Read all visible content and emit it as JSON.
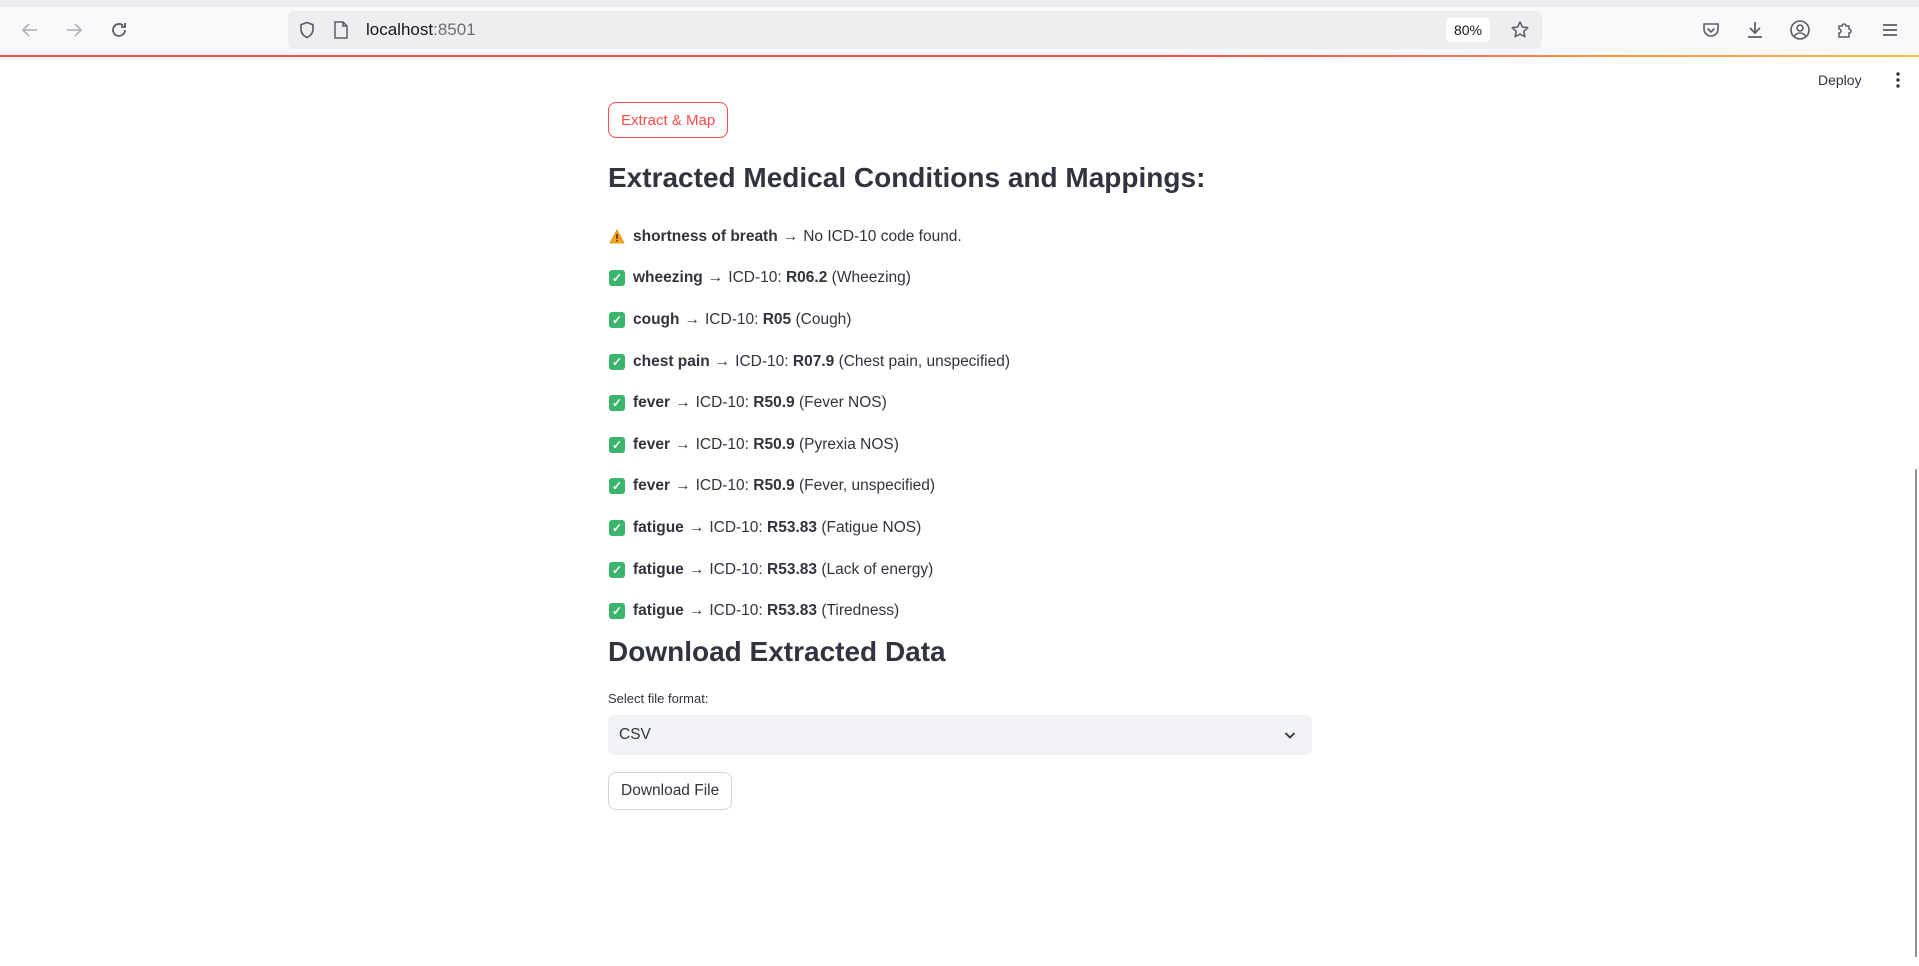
{
  "browser": {
    "url_host": "localhost",
    "url_port": ":8501",
    "zoom": "80%",
    "icons": [
      "back-icon",
      "forward-icon",
      "reload-icon",
      "shield-icon",
      "page-icon",
      "star-icon",
      "pocket-icon",
      "download-icon",
      "account-icon",
      "extensions-icon",
      "menu-icon"
    ]
  },
  "header": {
    "deploy_label": "Deploy"
  },
  "main": {
    "extract_button_label": "Extract & Map",
    "results_title": "Extracted Medical Conditions and Mappings:",
    "code_prefix": "ICD-10: ",
    "results": [
      {
        "status": "warning",
        "term": "shortness of breath",
        "arrow": "→",
        "message": "No ICD-10 code found."
      },
      {
        "status": "ok",
        "term": "wheezing",
        "arrow": "→",
        "code": "R06.2",
        "description": "(Wheezing)"
      },
      {
        "status": "ok",
        "term": "cough",
        "arrow": "→",
        "code": "R05",
        "description": "(Cough)"
      },
      {
        "status": "ok",
        "term": "chest pain",
        "arrow": "→",
        "code": "R07.9",
        "description": "(Chest pain, unspecified)"
      },
      {
        "status": "ok",
        "term": "fever",
        "arrow": "→",
        "code": "R50.9",
        "description": "(Fever NOS)"
      },
      {
        "status": "ok",
        "term": "fever",
        "arrow": "→",
        "code": "R50.9",
        "description": "(Pyrexia NOS)"
      },
      {
        "status": "ok",
        "term": "fever",
        "arrow": "→",
        "code": "R50.9",
        "description": "(Fever, unspecified)"
      },
      {
        "status": "ok",
        "term": "fatigue",
        "arrow": "→",
        "code": "R53.83",
        "description": "(Fatigue NOS)"
      },
      {
        "status": "ok",
        "term": "fatigue",
        "arrow": "→",
        "code": "R53.83",
        "description": "(Lack of energy)"
      },
      {
        "status": "ok",
        "term": "fatigue",
        "arrow": "→",
        "code": "R53.83",
        "description": "(Tiredness)"
      }
    ],
    "download_title": "Download Extracted Data",
    "format_label": "Select file format:",
    "format_selected": "CSV",
    "download_button_label": "Download File"
  },
  "colors": {
    "accent": "#ff4b4b",
    "text": "#31333f",
    "check_green": "#3bb56b",
    "warning_yellow": "#f5a623",
    "select_bg": "#f0f2f6"
  }
}
